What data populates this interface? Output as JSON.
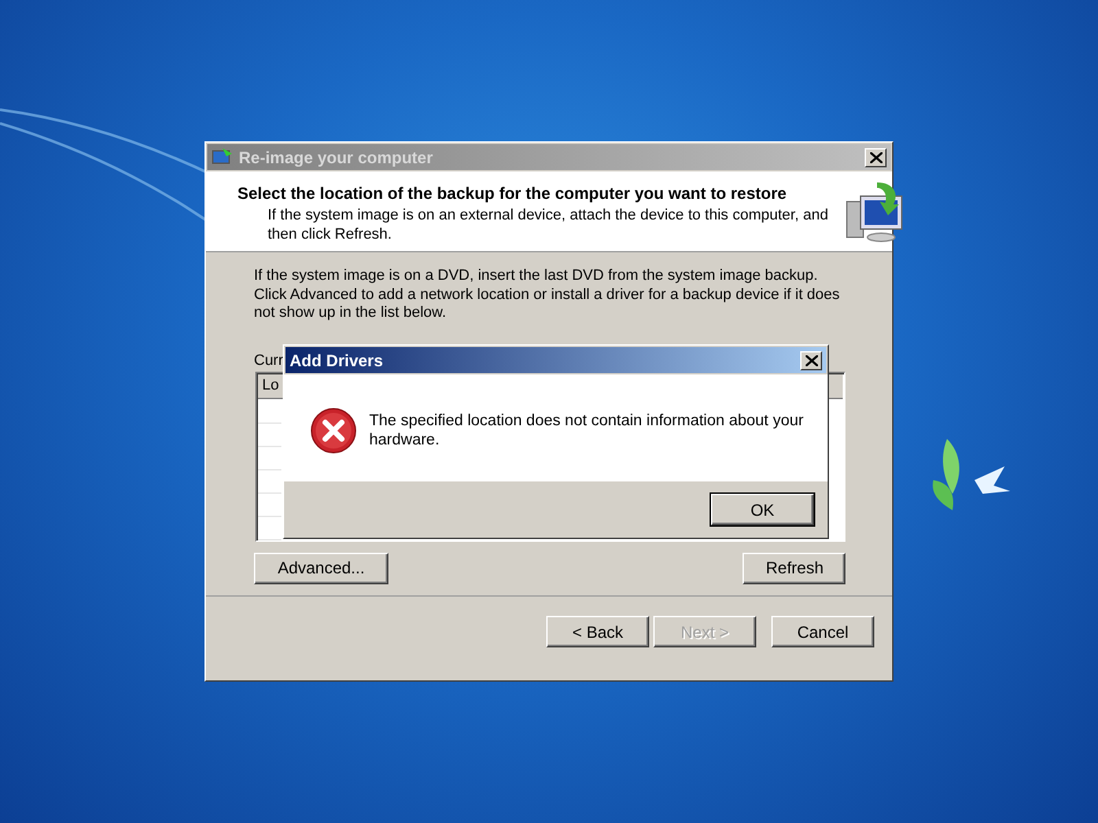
{
  "window": {
    "title": "Re-image your computer"
  },
  "header": {
    "heading": "Select the location of the backup for the computer you want to restore",
    "description": "If the system image is on an external device, attach the device to this computer, and then click Refresh."
  },
  "body": {
    "instructions": "If the system image is on a DVD, insert the last DVD from the system image backup. Click Advanced to add a network location or install a driver for a backup device if it does not show up in the list below.",
    "list_label": "Curr",
    "list": {
      "columns": [
        "Lo"
      ]
    }
  },
  "list_buttons": [
    "Advanced...",
    "Refresh"
  ],
  "nav_buttons": [
    {
      "label": "< Back",
      "disabled": false
    },
    {
      "label": "Next >",
      "disabled": true
    },
    {
      "label": "Cancel",
      "disabled": false
    }
  ],
  "dialog": {
    "title": "Add Drivers",
    "kind": "error",
    "message": "The specified location does not contain information about your hardware.",
    "button": "OK"
  }
}
